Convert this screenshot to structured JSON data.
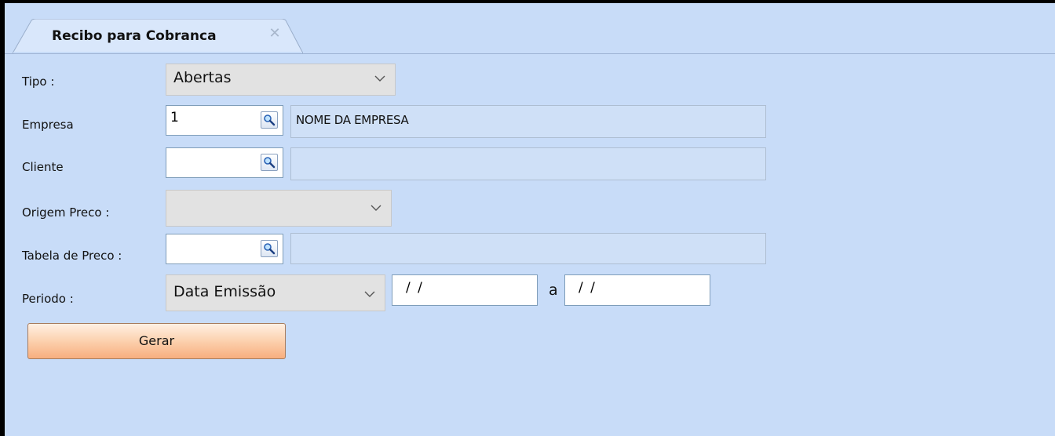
{
  "tab": {
    "title": "Recibo para Cobranca",
    "close_icon": "close-icon"
  },
  "form": {
    "tipo": {
      "label": "Tipo :",
      "value": "Abertas"
    },
    "empresa": {
      "label": "Empresa",
      "code": "1",
      "description": "NOME DA EMPRESA"
    },
    "cliente": {
      "label": "Cliente",
      "code": "",
      "description": ""
    },
    "origem_preco": {
      "label": "Origem Preco :",
      "value": ""
    },
    "tabela_preco": {
      "label": "Tabela de Preco :",
      "code": "",
      "description": ""
    },
    "periodo": {
      "label": "Periodo :",
      "type": "Data Emissão",
      "start": "/ /",
      "separator": "a",
      "end": "/ /"
    }
  },
  "actions": {
    "generate_label": "Gerar"
  },
  "colors": {
    "background": "#c8dcf8",
    "button_gradient_top": "#fff0e3",
    "button_gradient_bottom": "#f8ae7e",
    "close_icon": "#a7b6cb"
  }
}
